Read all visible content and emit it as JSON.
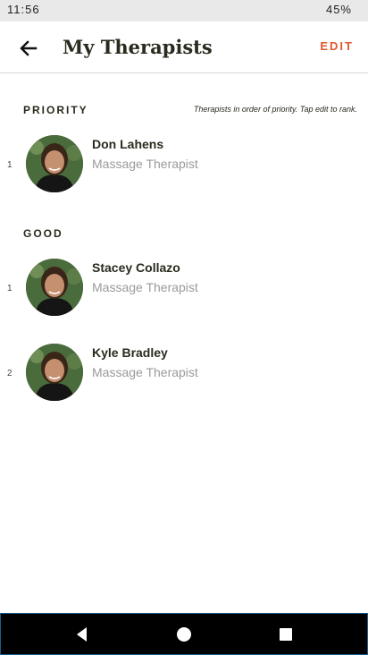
{
  "status_bar": {
    "time": "11:56",
    "battery": "45%"
  },
  "header": {
    "title": "My Therapists",
    "edit_label": "EDIT",
    "back_icon": "arrow-back-icon"
  },
  "priority_section": {
    "label": "PRIORITY",
    "hint": "Therapists in order of priority. Tap edit to rank.",
    "items": [
      {
        "rank": "1",
        "name": "Don Lahens",
        "role": "Massage Therapist"
      }
    ]
  },
  "good_section": {
    "label": "GOOD",
    "items": [
      {
        "rank": "1",
        "name": "Stacey Collazo",
        "role": "Massage Therapist"
      },
      {
        "rank": "2",
        "name": "Kyle Bradley",
        "role": "Massage Therapist"
      }
    ]
  },
  "nav_bar": {
    "back_icon": "triangle-back-icon",
    "home_icon": "circle-home-icon",
    "recents_icon": "square-recents-icon"
  },
  "colors": {
    "accent": "#e05a2e",
    "title": "#2a2a1e",
    "subtitle": "#9a9a9a"
  }
}
